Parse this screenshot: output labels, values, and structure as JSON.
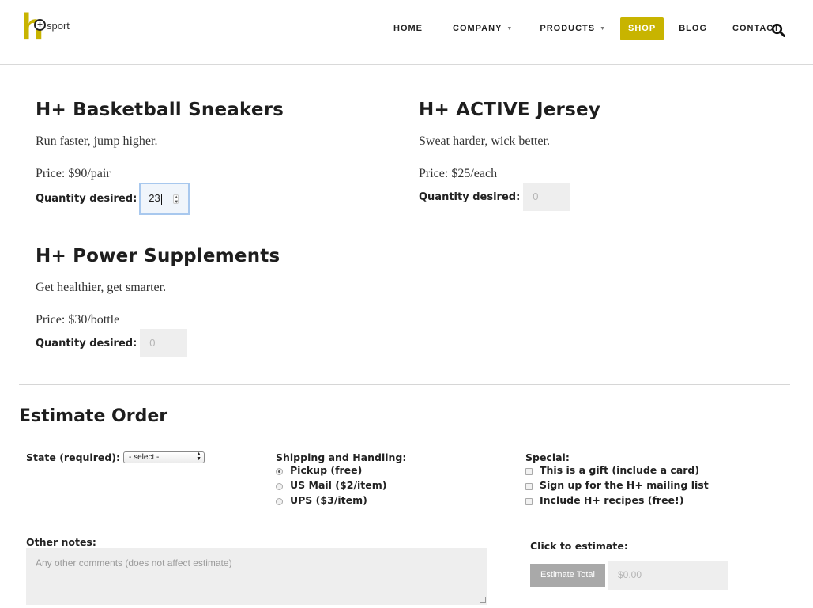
{
  "brand": {
    "logo_letter": "h",
    "logo_plus": "+",
    "logo_word": "sport",
    "accent": "#c8b400"
  },
  "nav": {
    "items": [
      {
        "label": "HOME"
      },
      {
        "label": "COMPANY"
      },
      {
        "label": "PRODUCTS"
      },
      {
        "label": "SHOP"
      },
      {
        "label": "BLOG"
      },
      {
        "label": "CONTACT"
      }
    ],
    "active": "SHOP",
    "search_icon": "search-icon"
  },
  "products": [
    {
      "name": "H+ Basketball Sneakers",
      "tagline": "Run faster, jump higher.",
      "price": "Price: $90/pair",
      "qty_label": "Quantity desired:",
      "qty_value": "23",
      "qty_placeholder": ""
    },
    {
      "name": "H+ ACTIVE Jersey",
      "tagline": "Sweat harder, wick better.",
      "price": "Price: $25/each",
      "qty_label": "Quantity desired:",
      "qty_value": "",
      "qty_placeholder": "0"
    },
    {
      "name": "H+ Power Supplements",
      "tagline": "Get healthier, get smarter.",
      "price": "Price: $30/bottle",
      "qty_label": "Quantity desired:",
      "qty_value": "",
      "qty_placeholder": "0"
    }
  ],
  "estimate": {
    "title": "Estimate Order",
    "state_label": "State (required):",
    "state_selected": "- select -",
    "shipping_label": "Shipping and Handling:",
    "shipping_options": [
      {
        "label": "Pickup (free)",
        "checked": true
      },
      {
        "label": "US Mail ($2/item)",
        "checked": false
      },
      {
        "label": "UPS ($3/item)",
        "checked": false
      }
    ],
    "special_label": "Special:",
    "special_options": [
      {
        "label": "This is a gift (include a card)",
        "checked": false
      },
      {
        "label": "Sign up for the H+ mailing list",
        "checked": false
      },
      {
        "label": "Include H+ recipes (free!)",
        "checked": false
      }
    ],
    "notes_label": "Other notes:",
    "notes_placeholder": "Any other comments (does not affect estimate)",
    "click_label": "Click to estimate:",
    "button_label": "Estimate Total",
    "total_placeholder": "$0.00"
  }
}
